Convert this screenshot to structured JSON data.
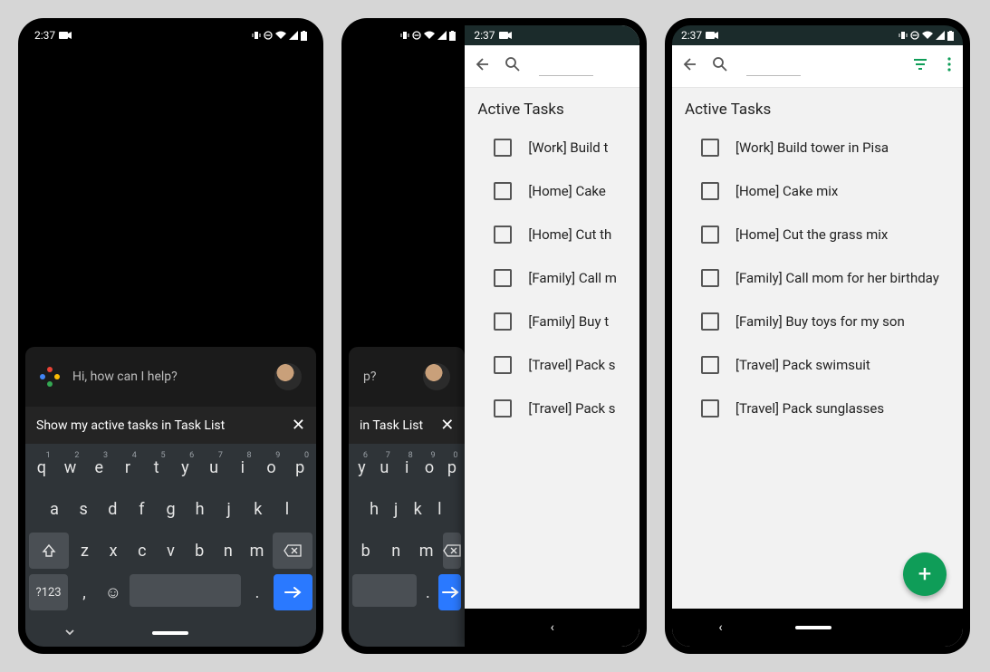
{
  "status": {
    "time": "2:37",
    "right_icons": [
      "vibrate",
      "dnd",
      "wifi",
      "signal",
      "battery"
    ]
  },
  "assistant": {
    "prompt": "Hi, how can I help?",
    "input_text": "Show my active tasks in Task List",
    "input_text_partial_mid": "in Task List",
    "input_text_partial_mid2": "p?"
  },
  "keyboard": {
    "row1": [
      {
        "k": "q",
        "n": "1"
      },
      {
        "k": "w",
        "n": "2"
      },
      {
        "k": "e",
        "n": "3"
      },
      {
        "k": "r",
        "n": "4"
      },
      {
        "k": "t",
        "n": "5"
      },
      {
        "k": "y",
        "n": "6"
      },
      {
        "k": "u",
        "n": "7"
      },
      {
        "k": "i",
        "n": "8"
      },
      {
        "k": "o",
        "n": "9"
      },
      {
        "k": "p",
        "n": "0"
      }
    ],
    "row2": [
      "a",
      "s",
      "d",
      "f",
      "g",
      "h",
      "j",
      "k",
      "l"
    ],
    "row3": [
      "z",
      "x",
      "c",
      "v",
      "b",
      "n",
      "m"
    ],
    "sym": "?123",
    "comma": ",",
    "period": "."
  },
  "app": {
    "section_title": "Active Tasks",
    "tasks": [
      "[Work] Build tower in Pisa",
      "[Home] Cake mix",
      "[Home] Cut the grass mix",
      "[Family] Call mom for her birthday",
      "[Family] Buy toys for my son",
      "[Travel] Pack swimsuit",
      "[Travel] Pack sunglasses"
    ],
    "tasks_clipped": [
      "[Work] Build t",
      "[Home] Cake",
      "[Home] Cut th",
      "[Family] Call m",
      "[Family] Buy t",
      "[Travel] Pack s",
      "[Travel] Pack s"
    ]
  }
}
